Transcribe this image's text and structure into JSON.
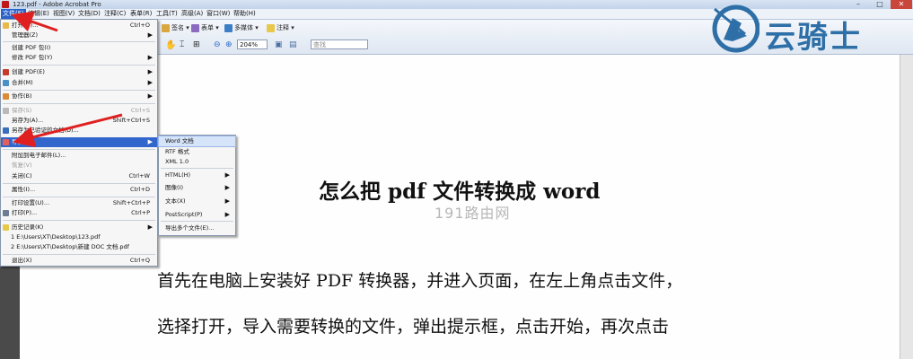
{
  "window": {
    "title": "123.pdf - Adobe Acrobat Pro",
    "min": "–",
    "max": "□",
    "close": "✕"
  },
  "menubar": [
    "文件(F)",
    "编辑(E)",
    "视图(V)",
    "文档(D)",
    "注释(C)",
    "表单(R)",
    "工具(T)",
    "高级(A)",
    "窗口(W)",
    "帮助(H)"
  ],
  "toolbar": {
    "sign": "签名",
    "forms": "表单",
    "multimedia": "多媒体",
    "comment": "注释",
    "zoom": "204%",
    "search": "查找"
  },
  "file_menu": {
    "items": [
      {
        "label": "打开(O)...",
        "shortcut": "Ctrl+O",
        "submenu": false,
        "disabled": false
      },
      {
        "label": "管理器(Z)",
        "shortcut": "",
        "submenu": true,
        "disabled": false
      },
      {
        "label": "创建 PDF 包(I)",
        "shortcut": "",
        "submenu": false,
        "disabled": false
      },
      {
        "label": "修改 PDF 包(Y)",
        "shortcut": "",
        "submenu": true,
        "disabled": false
      },
      {
        "label": "创建 PDF(E)",
        "shortcut": "",
        "submenu": true,
        "disabled": false
      },
      {
        "label": "合并(M)",
        "shortcut": "",
        "submenu": true,
        "disabled": false
      },
      {
        "label": "协作(B)",
        "shortcut": "",
        "submenu": true,
        "disabled": false
      },
      {
        "label": "保存(S)",
        "shortcut": "Ctrl+S",
        "submenu": false,
        "disabled": true
      },
      {
        "label": "另存为(A)...",
        "shortcut": "Shift+Ctrl+S",
        "submenu": false,
        "disabled": false
      },
      {
        "label": "另存为已验证的文档(D)...",
        "shortcut": "",
        "submenu": false,
        "disabled": false
      },
      {
        "label": "导出(I)",
        "shortcut": "",
        "submenu": true,
        "disabled": false
      },
      {
        "label": "附加到电子邮件(L)...",
        "shortcut": "",
        "submenu": false,
        "disabled": false
      },
      {
        "label": "恢复(V)",
        "shortcut": "",
        "submenu": false,
        "disabled": true
      },
      {
        "label": "关闭(C)",
        "shortcut": "Ctrl+W",
        "submenu": false,
        "disabled": false
      },
      {
        "label": "属性(I)...",
        "shortcut": "Ctrl+D",
        "submenu": false,
        "disabled": false
      },
      {
        "label": "打印设置(U)...",
        "shortcut": "Shift+Ctrl+P",
        "submenu": false,
        "disabled": false
      },
      {
        "label": "打印(P)...",
        "shortcut": "Ctrl+P",
        "submenu": false,
        "disabled": false
      },
      {
        "label": "历史记录(K)",
        "shortcut": "",
        "submenu": true,
        "disabled": false
      },
      {
        "label": "1 E:\\Users\\XT\\Desktop\\123.pdf",
        "shortcut": "",
        "submenu": false,
        "disabled": false
      },
      {
        "label": "2 E:\\Users\\XT\\Desktop\\新建 DOC 文档.pdf",
        "shortcut": "",
        "submenu": false,
        "disabled": false
      },
      {
        "label": "退出(X)",
        "shortcut": "Ctrl+Q",
        "submenu": false,
        "disabled": false
      }
    ]
  },
  "export_submenu": {
    "items": [
      {
        "label": "Word 文档",
        "submenu": false
      },
      {
        "label": "RTF 格式",
        "submenu": false
      },
      {
        "label": "XML 1.0",
        "submenu": false
      },
      {
        "label": "HTML(H)",
        "submenu": true
      },
      {
        "label": "图像(I)",
        "submenu": true
      },
      {
        "label": "文本(X)",
        "submenu": true
      },
      {
        "label": "PostScript(P)",
        "submenu": true
      },
      {
        "label": "导出多个文件(E)...",
        "submenu": false
      }
    ]
  },
  "document": {
    "title": "怎么把 pdf 文件转换成 word",
    "watermark": "191路由网",
    "para1": "首先在电脑上安装好 PDF 转换器，并进入页面，在左上角点击文件，",
    "para2": "选择打开，导入需要转换的文件，弹出提示框，点击开始，再次点击"
  },
  "logo": {
    "text": "云骑士"
  },
  "colors": {
    "highlight": "#3366cc",
    "annotation_arrow": "#e02020",
    "logo": "#2d6fa6"
  }
}
